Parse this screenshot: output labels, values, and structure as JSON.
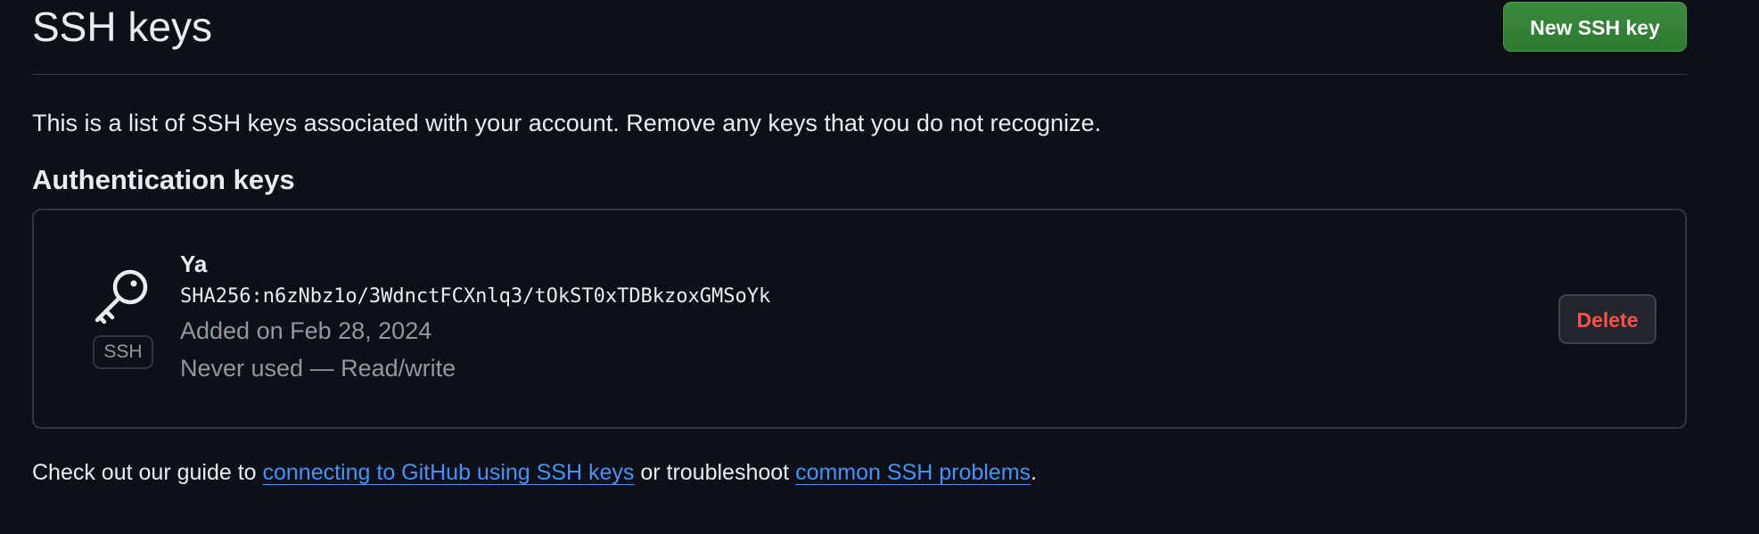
{
  "page": {
    "title": "SSH keys",
    "new_key_button": "New SSH key",
    "intro": "This is a list of SSH keys associated with your account. Remove any keys that you do not recognize."
  },
  "auth_section": {
    "heading": "Authentication keys",
    "keys": [
      {
        "name": "Ya",
        "fingerprint": "SHA256:n6zNbz1o/3WdnctFCXnlq3/tOkST0xTDBkzoxGMSoYk",
        "added": "Added on Feb 28, 2024",
        "usage": "Never used — Read/write",
        "badge": "SSH",
        "icon": "key-icon",
        "delete_label": "Delete"
      }
    ]
  },
  "footer": {
    "prefix": "Check out our guide to ",
    "link1": "connecting to GitHub using SSH keys",
    "middle": " or troubleshoot ",
    "link2": "common SSH problems",
    "suffix": "."
  },
  "colors": {
    "background": "#0d1117",
    "primary_button": "#2f7d32",
    "danger_text": "#f85149",
    "link": "#4493f8",
    "muted_text": "#9198a1",
    "border": "#30363d"
  }
}
